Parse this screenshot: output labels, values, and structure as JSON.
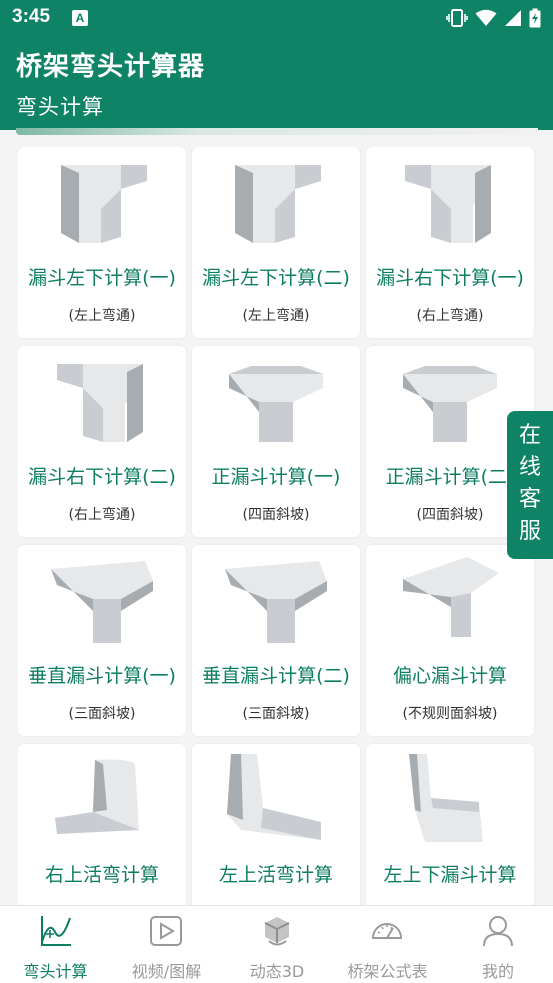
{
  "status_bar": {
    "time": "3:45",
    "notification_icon_letter": "A",
    "icons": [
      "vibrate-icon",
      "wifi-icon",
      "signal-icon",
      "battery-charging-icon"
    ]
  },
  "header": {
    "title": "桥架弯头计算器",
    "subtitle": "弯头计算"
  },
  "cards": [
    {
      "title": "漏斗左下计算(一)",
      "sub": "(左上弯通)",
      "icon": "funnel-left-bend-icon"
    },
    {
      "title": "漏斗左下计算(二)",
      "sub": "(左上弯通)",
      "icon": "funnel-left-bend-icon"
    },
    {
      "title": "漏斗右下计算(一)",
      "sub": "(右上弯通)",
      "icon": "funnel-right-bend-icon"
    },
    {
      "title": "漏斗右下计算(二)",
      "sub": "(右上弯通)",
      "icon": "funnel-right-bend-icon"
    },
    {
      "title": "正漏斗计算(一)",
      "sub": "(四面斜坡)",
      "icon": "funnel-four-slope-icon"
    },
    {
      "title": "正漏斗计算(二)",
      "sub": "(四面斜坡)",
      "icon": "funnel-four-slope-icon"
    },
    {
      "title": "垂直漏斗计算(一)",
      "sub": "(三面斜坡)",
      "icon": "vertical-funnel-icon"
    },
    {
      "title": "垂直漏斗计算(二)",
      "sub": "(三面斜坡)",
      "icon": "vertical-funnel-icon"
    },
    {
      "title": "偏心漏斗计算",
      "sub": "(不规则面斜坡)",
      "icon": "eccentric-funnel-icon"
    },
    {
      "title": "右上活弯计算",
      "sub": "",
      "icon": "right-up-bend-icon"
    },
    {
      "title": "左上活弯计算",
      "sub": "",
      "icon": "left-up-bend-icon"
    },
    {
      "title": "左上下漏斗计算",
      "sub": "",
      "icon": "left-updown-funnel-icon"
    }
  ],
  "service_button": {
    "chars": [
      "在",
      "线",
      "客",
      "服"
    ]
  },
  "bottom_nav": [
    {
      "label": "弯头计算",
      "icon": "chart-curve-icon",
      "active": true
    },
    {
      "label": "视频/图解",
      "icon": "video-play-icon",
      "active": false
    },
    {
      "label": "动态3D",
      "icon": "3d-cube-icon",
      "active": false
    },
    {
      "label": "桥架公式表",
      "icon": "gauge-icon",
      "active": false
    },
    {
      "label": "我的",
      "icon": "user-icon",
      "active": false
    }
  ],
  "colors": {
    "primary": "#0e8366",
    "text_accent": "#0e7e62",
    "background": "#f4f4f4"
  }
}
